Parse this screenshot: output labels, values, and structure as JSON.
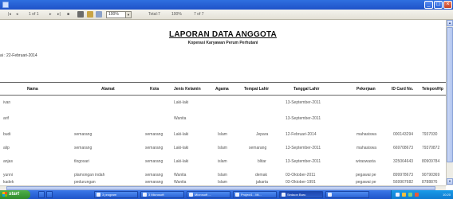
{
  "toolbar": {
    "page": "1 of 1",
    "zoom": "100%",
    "total": "Total:7",
    "percent": "100%",
    "count": "7 of 7"
  },
  "report": {
    "title": "LAPORAN DATA ANGGOTA",
    "subtitle": "Koperasi Karyawan Perum Perhutani",
    "date_line": "ai : 22-Februari-2014",
    "columns": [
      "Nama",
      "Alamat",
      "Kota",
      "Jenis Kelamin",
      "Agama",
      "Tempat Lahir",
      "Tanggal Lahir",
      "Pekerjaan",
      "ID Card No.",
      "Telepon/Hp"
    ],
    "rows": [
      [
        "ivan",
        "",
        "",
        "Laki-laki",
        "",
        "",
        "13-September-2011",
        "",
        "",
        ""
      ],
      [
        "arif",
        "",
        "",
        "Wanita",
        "",
        "",
        "13-September-2011",
        "",
        "",
        ""
      ],
      [
        "budi",
        "semarang",
        "semarang",
        "Laki-laki",
        "Islam",
        "Jepara",
        "12-Februari-2014",
        "mahasiswa",
        "000143294",
        "7937030"
      ],
      [
        "alip",
        "semarang",
        "semarang",
        "Laki-laki",
        "Islam",
        "semarang",
        "13-September-2011",
        "mahasiswa",
        "669708673",
        "79370872"
      ],
      [
        "anjas",
        "tlogosari",
        "semarang",
        "Laki-laki",
        "islam",
        "blitar",
        "13-September-2011",
        "wiraswasta",
        "325064643",
        "80909784"
      ],
      [
        "yunni",
        "plamongan indah",
        "semarang",
        "Wanita",
        "Islam",
        "demak",
        "03-Oktober-2011",
        "pegawai pe",
        "899978673",
        "90790369"
      ],
      [
        "kadek",
        "pedurungan",
        "semarang",
        "Wanita",
        "Islam",
        "jakarta",
        "03-Oktober-1991",
        "pegawai pe",
        "569907682",
        "8788876"
      ]
    ]
  },
  "taskbar": {
    "start": "start",
    "tasks": [
      "3 program",
      "3 Microsoft",
      "Microsoft ...",
      "Project1 - Mi...",
      "Sedaon Baru",
      ""
    ],
    "clock": "10:20"
  },
  "colors": {
    "titlebar": "#1f52c8",
    "taskbar": "#2b63d6",
    "start": "#2e8a2b"
  }
}
